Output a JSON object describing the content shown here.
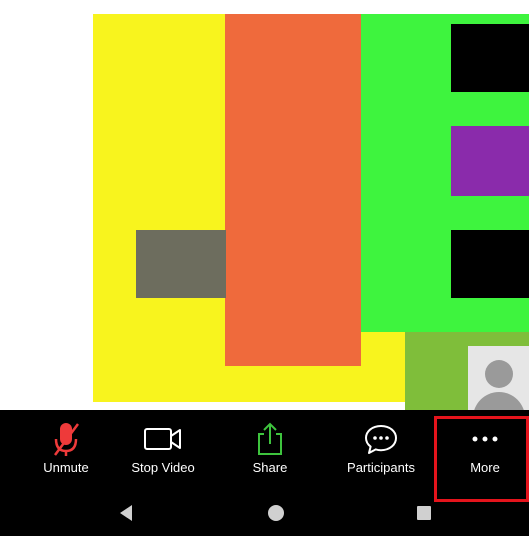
{
  "toolbar": {
    "unmute_label": "Unmute",
    "stop_video_label": "Stop Video",
    "share_label": "Share",
    "participants_label": "Participants",
    "more_label": "More"
  },
  "icons": {
    "mic_muted": "microphone-muted-icon",
    "video": "video-camera-icon",
    "share": "share-upload-icon",
    "participants": "chat-bubble-icon",
    "more": "ellipsis-icon",
    "nav_back": "back-triangle-icon",
    "nav_home": "home-circle-icon",
    "nav_recents": "recents-square-icon"
  },
  "colors": {
    "muted_red": "#ee3a3a",
    "share_green": "#3ec43e",
    "highlight_red": "#e5141c",
    "toolbar_bg": "#000000"
  }
}
